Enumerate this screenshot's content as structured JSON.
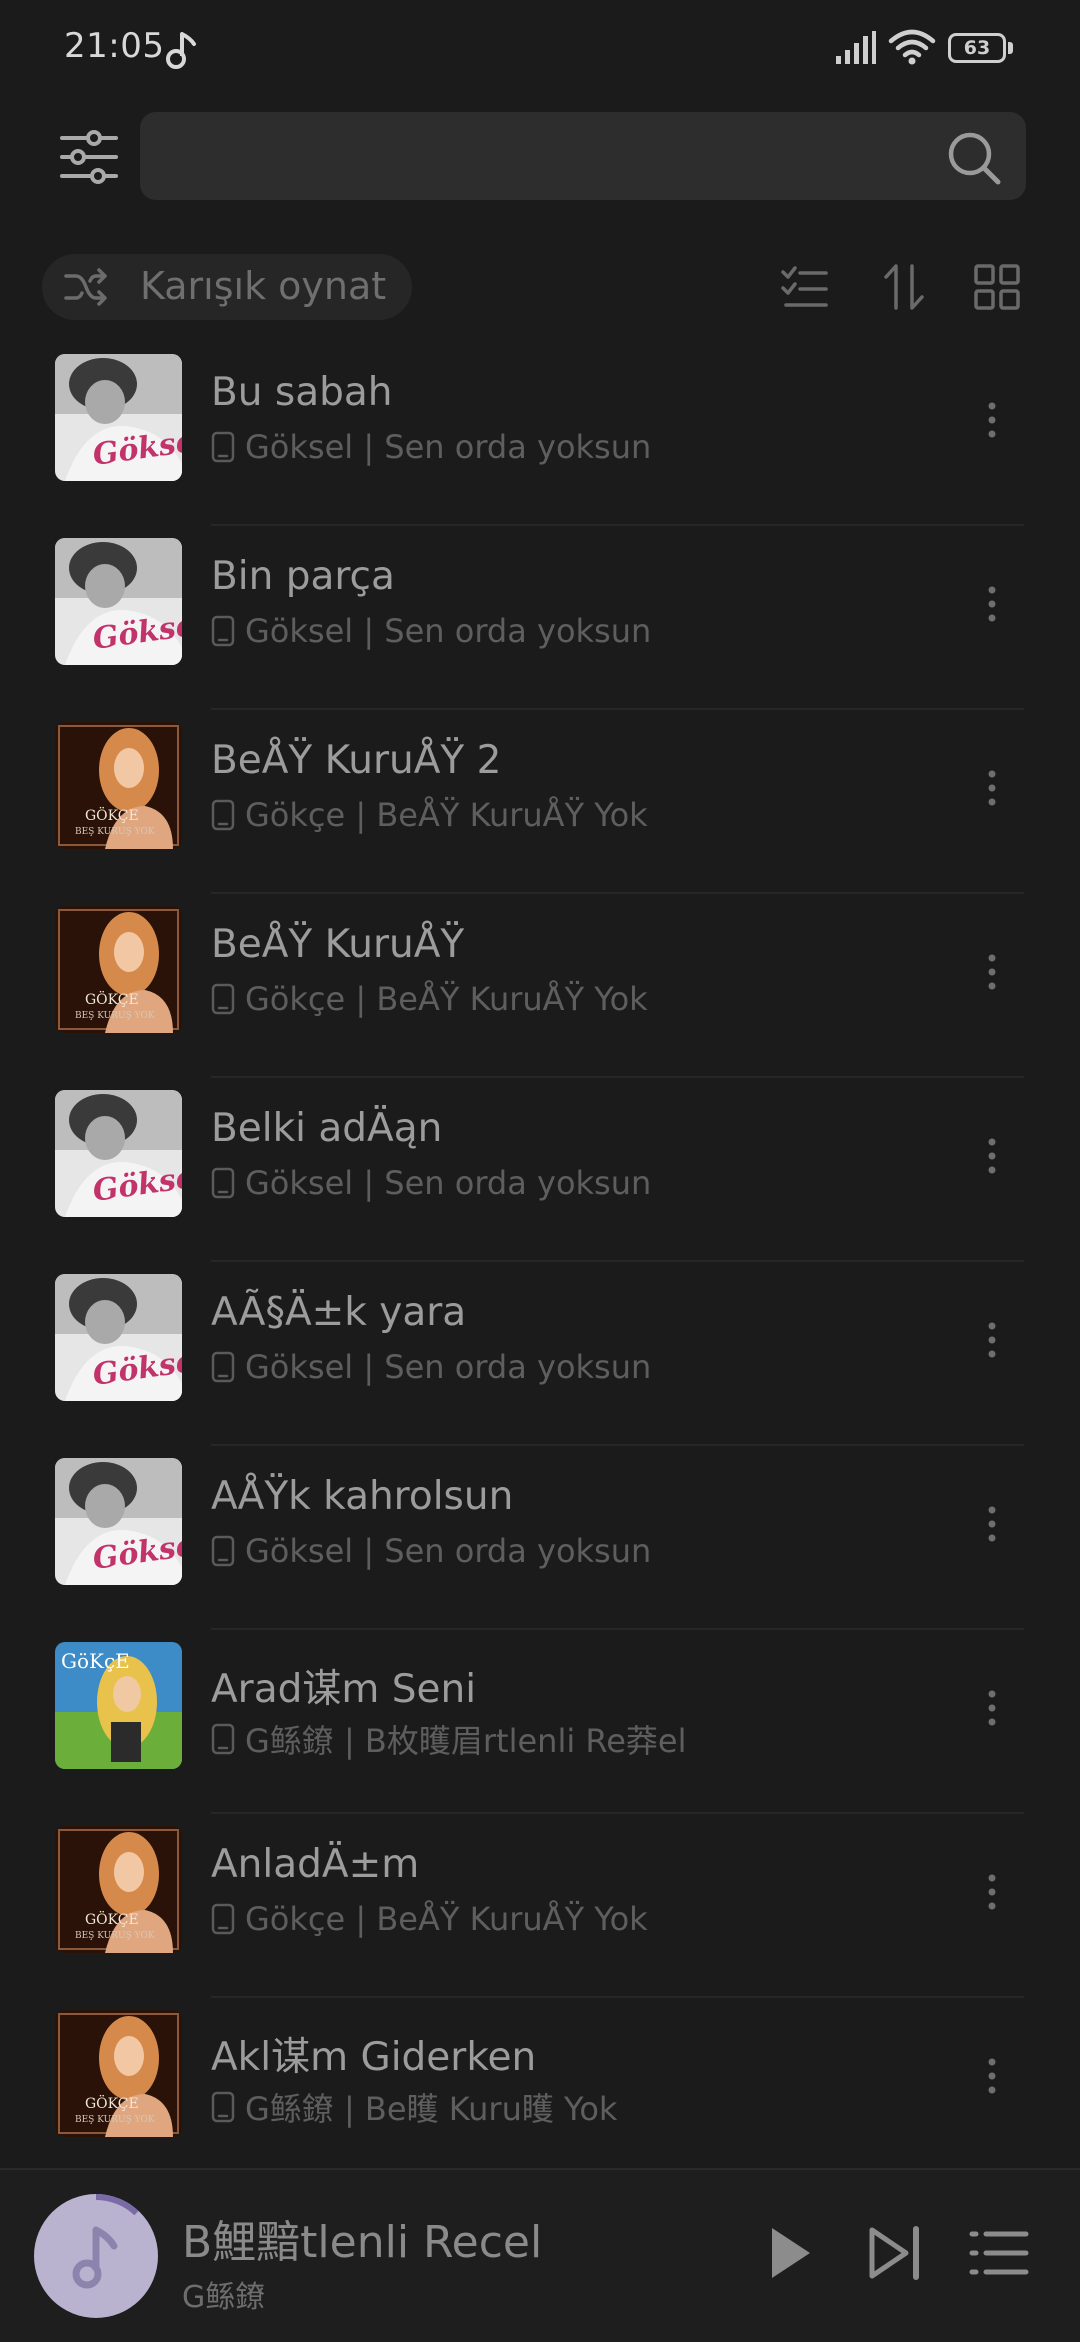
{
  "status_bar": {
    "time": "21:05",
    "battery": "63",
    "icons": [
      "music-note-icon",
      "signal-icon",
      "wifi-icon",
      "battery-icon"
    ]
  },
  "header": {
    "search_placeholder": "",
    "icons": [
      "filter-sliders-icon",
      "search-icon"
    ]
  },
  "toolbar": {
    "shuffle_label": "Karışık oynat",
    "icons": [
      "shuffle-icon",
      "multi-select-icon",
      "sort-icon",
      "grid-view-icon"
    ]
  },
  "songs": [
    {
      "title": "Bu sabah",
      "subtitle": "Göksel | Sen orda yoksun",
      "cover": "goksel"
    },
    {
      "title": "Bin parça",
      "subtitle": "Göksel | Sen orda yoksun",
      "cover": "goksel"
    },
    {
      "title": "BeÅŸ KuruÅŸ 2",
      "subtitle": "Gökçe | BeÅŸ KuruÅŸ Yok",
      "cover": "gokce"
    },
    {
      "title": "BeÅŸ KuruÅŸ",
      "subtitle": "Gökçe | BeÅŸ KuruÅŸ Yok",
      "cover": "gokce"
    },
    {
      "title": "Belki adÄąn",
      "subtitle": "Göksel | Sen orda yoksun",
      "cover": "goksel"
    },
    {
      "title": "AÃ§Ä±k yara",
      "subtitle": "Göksel | Sen orda yoksun",
      "cover": "goksel"
    },
    {
      "title": "AÅŸk kahrolsun",
      "subtitle": "Göksel | Sen orda yoksun",
      "cover": "goksel"
    },
    {
      "title": "Arad谋m Seni",
      "subtitle": "G鲧鐐 | B枚矆眉rtlenli Re莽el",
      "cover": "gokce-alt"
    },
    {
      "title": "AnladÄ±m",
      "subtitle": "Gökçe | BeÅŸ KuruÅŸ Yok",
      "cover": "gokce"
    },
    {
      "title": "Akl谋m Giderken",
      "subtitle": "G鲧鐐 | Be矆 Kuru矆 Yok",
      "cover": "gokce"
    }
  ],
  "mini_player": {
    "title": "B鯉黯tlenli Recel",
    "artist": "G鲧鐐",
    "progress": 0.12,
    "icons": [
      "music-note-icon",
      "play-icon",
      "skip-next-icon",
      "playlist-icon"
    ]
  },
  "colors": {
    "background": "#1b1b1b",
    "accent": "#8a7fb5",
    "goksel_pink": "#c2336b",
    "gokce_bg": "#2a1208"
  }
}
